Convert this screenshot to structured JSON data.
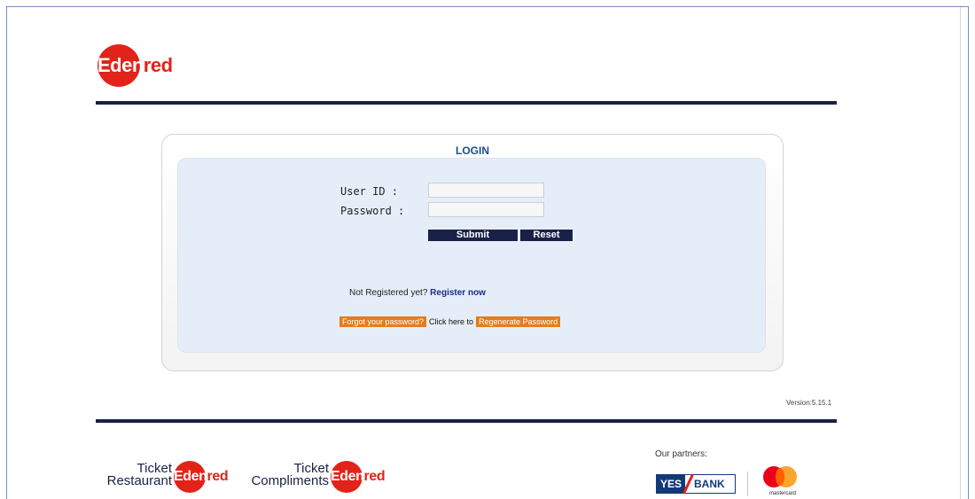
{
  "header": {
    "logo_part1": "Eden",
    "logo_part2": "red"
  },
  "login": {
    "title": "LOGIN",
    "user_id_label": "User ID :",
    "password_label": "Password :",
    "user_id_value": "",
    "password_value": "",
    "submit_label": "Submit",
    "reset_label": "Reset",
    "not_registered_text": "Not Registered yet?",
    "register_link": "Register now",
    "forgot_label": "Forgot your password?",
    "click_here_text": "Click here to",
    "regenerate_label": "Regenerate Password"
  },
  "version": "Version:5.15.1",
  "footer": {
    "ticket_restaurant": {
      "line1": "Ticket",
      "line2": "Restaurant",
      "logo_part1": "Eden",
      "logo_part2": "red"
    },
    "ticket_compliments": {
      "line1": "Ticket",
      "line2": "Compliments",
      "logo_part1": "Eden",
      "logo_part2": "red"
    },
    "partners_label": "Our partners:",
    "yes_bank_yes": "YES",
    "yes_bank_bank": "BANK",
    "mastercard_label": "mastercard"
  },
  "colors": {
    "brand_red": "#e2231a",
    "navy": "#1a2148",
    "orange": "#e57c1e",
    "link_blue": "#1b2a8a"
  }
}
